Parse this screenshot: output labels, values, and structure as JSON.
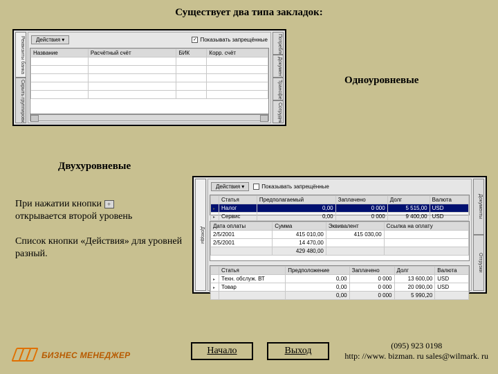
{
  "title": "Существует два типа закладок:",
  "label_single": "Одноуровневые",
  "label_double": "Двухуровневые",
  "text_expand_1": "При нажатии кнопки ",
  "text_expand_2": "открывается второй уровень",
  "text_actions": "Список кнопки «Действия» для уровней разный.",
  "panel1": {
    "actions_btn": "Действия ▾",
    "checkbox": "Показывать запрещённые",
    "vtabs_left": [
      "Реквизиты банка",
      "Скрыть группировки"
    ],
    "vtabs_right": [
      "Потребление",
      "Документы",
      "Трансферы",
      "Сотрудни-"
    ],
    "cols": [
      "Название",
      "Расчётный счёт",
      "БИК",
      "Корр. счёт"
    ]
  },
  "panel2": {
    "actions_btn": "Действия ▾",
    "checkbox": "Показывать запрещённые",
    "vtabs_left": [
      "Доходы"
    ],
    "vtabs_right": [
      "Документы",
      "Отгрузки"
    ],
    "grid1": {
      "cols": [
        "",
        "Статья",
        "Предполагаемый",
        "Заплачено",
        "Долг",
        "Валюта"
      ],
      "rows": [
        [
          "+",
          "Налог",
          "0,00",
          "0 000",
          "5 515,00",
          "USD"
        ],
        [
          "+",
          "Сервис",
          "0,00",
          "0 000",
          "9 400,00",
          "USD"
        ]
      ]
    },
    "grid2": {
      "cols": [
        "Дата оплаты",
        "Сумма",
        "Эквивалент",
        "Ссылка на оплату"
      ],
      "rows": [
        [
          "2/5/2001",
          "415 010,00",
          "415 030,00",
          ""
        ],
        [
          "2/5/2001",
          "14 470,00",
          "",
          ""
        ]
      ],
      "footer": [
        "",
        "429 480,00",
        "",
        ""
      ]
    },
    "grid3": {
      "cols": [
        "",
        "Статья",
        "Предположение",
        "Заплачено",
        "Долг",
        "Валюта"
      ],
      "rows": [
        [
          "+",
          "Техн. обслуж. ВТ",
          "0,00",
          "0 000",
          "13 600,00",
          "USD"
        ],
        [
          "+",
          "Товар",
          "0,00",
          "0 000",
          "20 090,00",
          "USD"
        ]
      ],
      "footer": [
        "",
        "",
        "0,00",
        "0 000",
        "5 990,20",
        ""
      ]
    }
  },
  "nav": {
    "start": "Начало",
    "exit": "Выход"
  },
  "contact": {
    "phone": "(095) 923 0198",
    "line2": "http: //www. bizman. ru  sales@wilmark. ru"
  },
  "logo": "БИЗНЕС МЕНЕДЖЕР"
}
